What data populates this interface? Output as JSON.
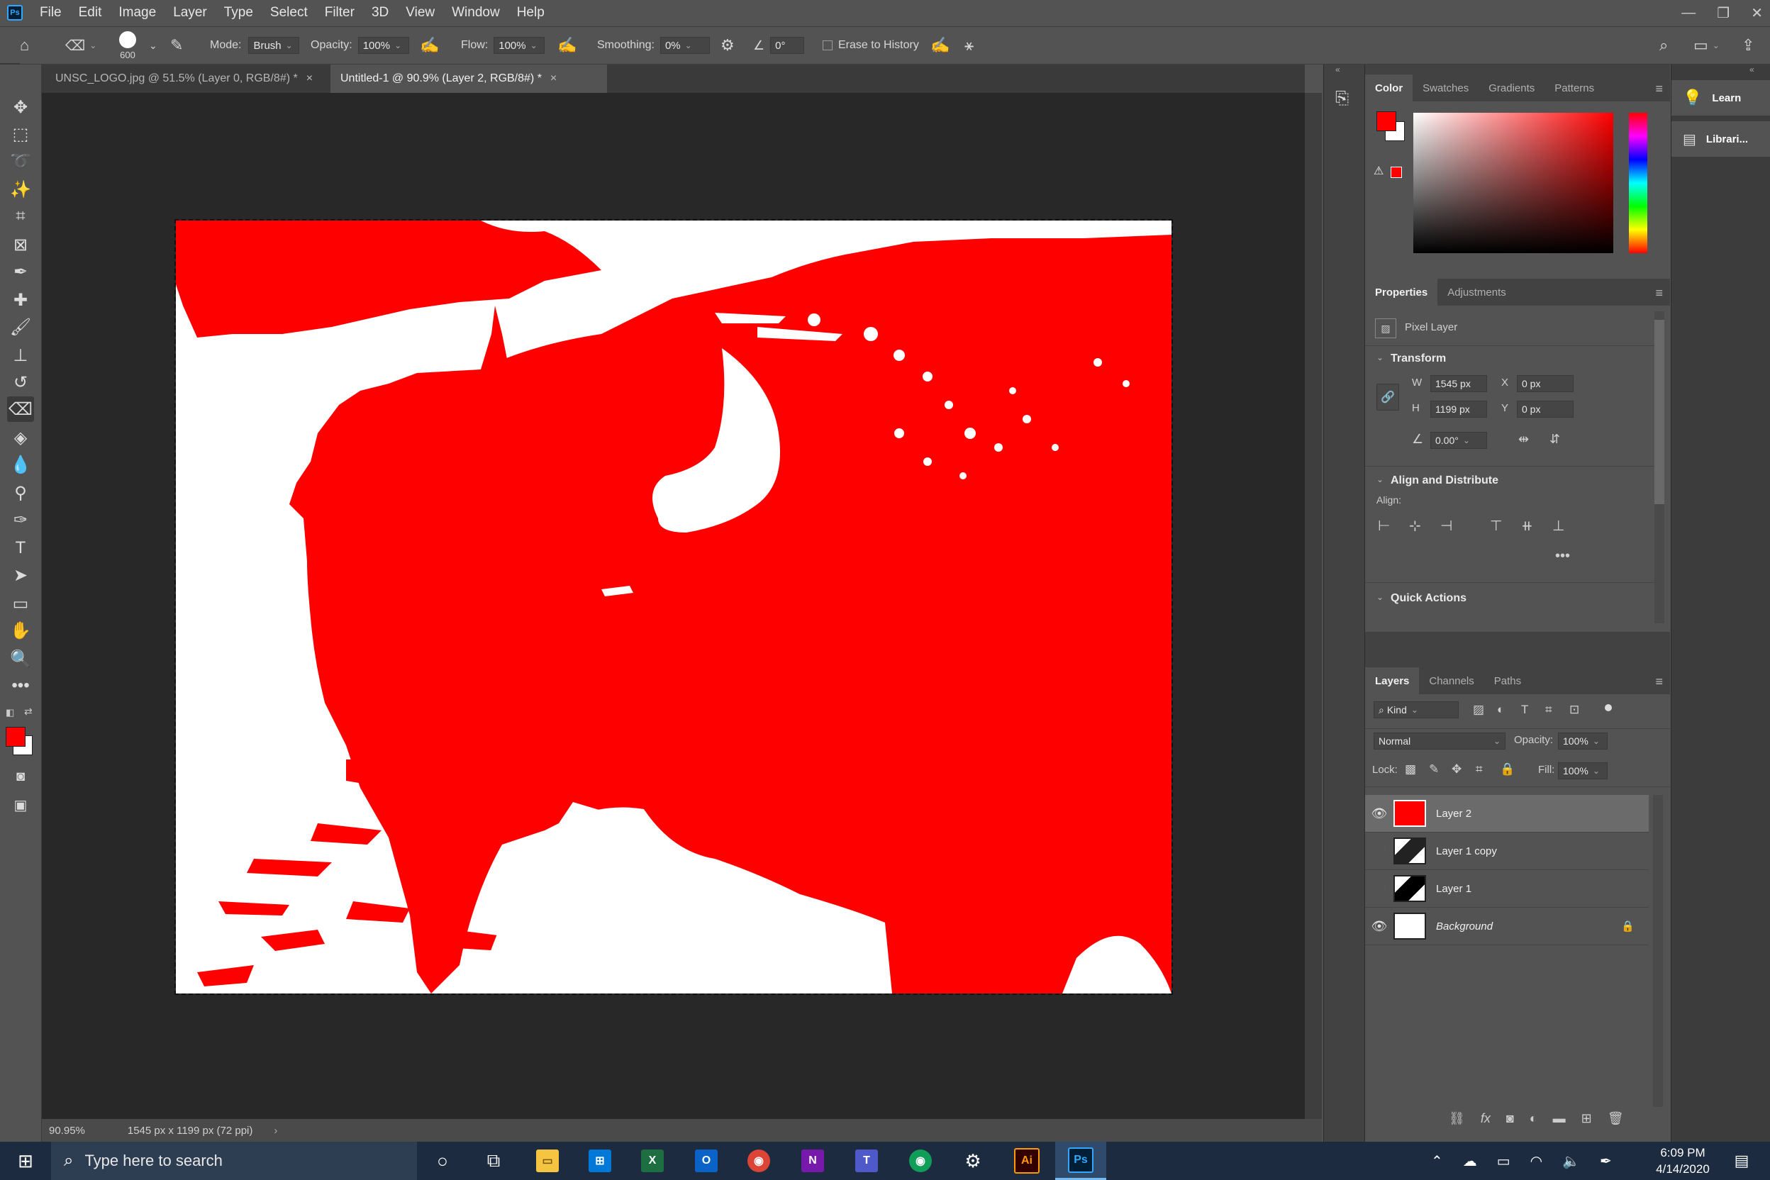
{
  "menu": [
    "File",
    "Edit",
    "Image",
    "Layer",
    "Type",
    "Select",
    "Filter",
    "3D",
    "View",
    "Window",
    "Help"
  ],
  "options": {
    "brush_size": "600",
    "mode_label": "Mode:",
    "mode_value": "Brush",
    "opacity_label": "Opacity:",
    "opacity_value": "100%",
    "flow_label": "Flow:",
    "flow_value": "100%",
    "smoothing_label": "Smoothing:",
    "smoothing_value": "0%",
    "angle_value": "0°",
    "erase_history_label": "Erase to History"
  },
  "tabs": [
    {
      "label": "UNSC_LOGO.jpg @ 51.5% (Layer 0, RGB/8#) *",
      "active": false
    },
    {
      "label": "Untitled-1 @ 90.9% (Layer 2, RGB/8#) *",
      "active": true
    }
  ],
  "status": {
    "zoom": "90.95%",
    "doc_info": "1545 px x 1199 px (72 ppi)"
  },
  "colors": {
    "foreground": "#ff0000",
    "background": "#ffffff",
    "accent": "#31a8ff"
  },
  "color_panel": {
    "tabs": [
      "Color",
      "Swatches",
      "Gradients",
      "Patterns"
    ]
  },
  "properties": {
    "tabs": [
      "Properties",
      "Adjustments"
    ],
    "kind": "Pixel Layer",
    "transform_title": "Transform",
    "w_label": "W",
    "w": "1545 px",
    "h_label": "H",
    "h": "1199 px",
    "x_label": "X",
    "x": "0 px",
    "y_label": "Y",
    "y": "0 px",
    "angle": "0.00°",
    "align_title": "Align and Distribute",
    "align_label": "Align:",
    "quick_title": "Quick Actions"
  },
  "layers_panel": {
    "tabs": [
      "Layers",
      "Channels",
      "Paths"
    ],
    "filter_kind": "Kind",
    "blend_mode": "Normal",
    "opacity_label": "Opacity:",
    "opacity": "100%",
    "lock_label": "Lock:",
    "fill_label": "Fill:",
    "fill": "100%",
    "layers": [
      {
        "name": "Layer 2",
        "visible": true,
        "selected": true
      },
      {
        "name": "Layer 1 copy",
        "visible": false,
        "selected": false
      },
      {
        "name": "Layer 1",
        "visible": false,
        "selected": false
      },
      {
        "name": "Background",
        "visible": true,
        "selected": false,
        "locked": true
      }
    ]
  },
  "side_panels": {
    "learn": "Learn",
    "libraries": "Librari..."
  },
  "taskbar": {
    "search_placeholder": "Type here to search",
    "time": "6:09 PM",
    "date": "4/14/2020"
  }
}
